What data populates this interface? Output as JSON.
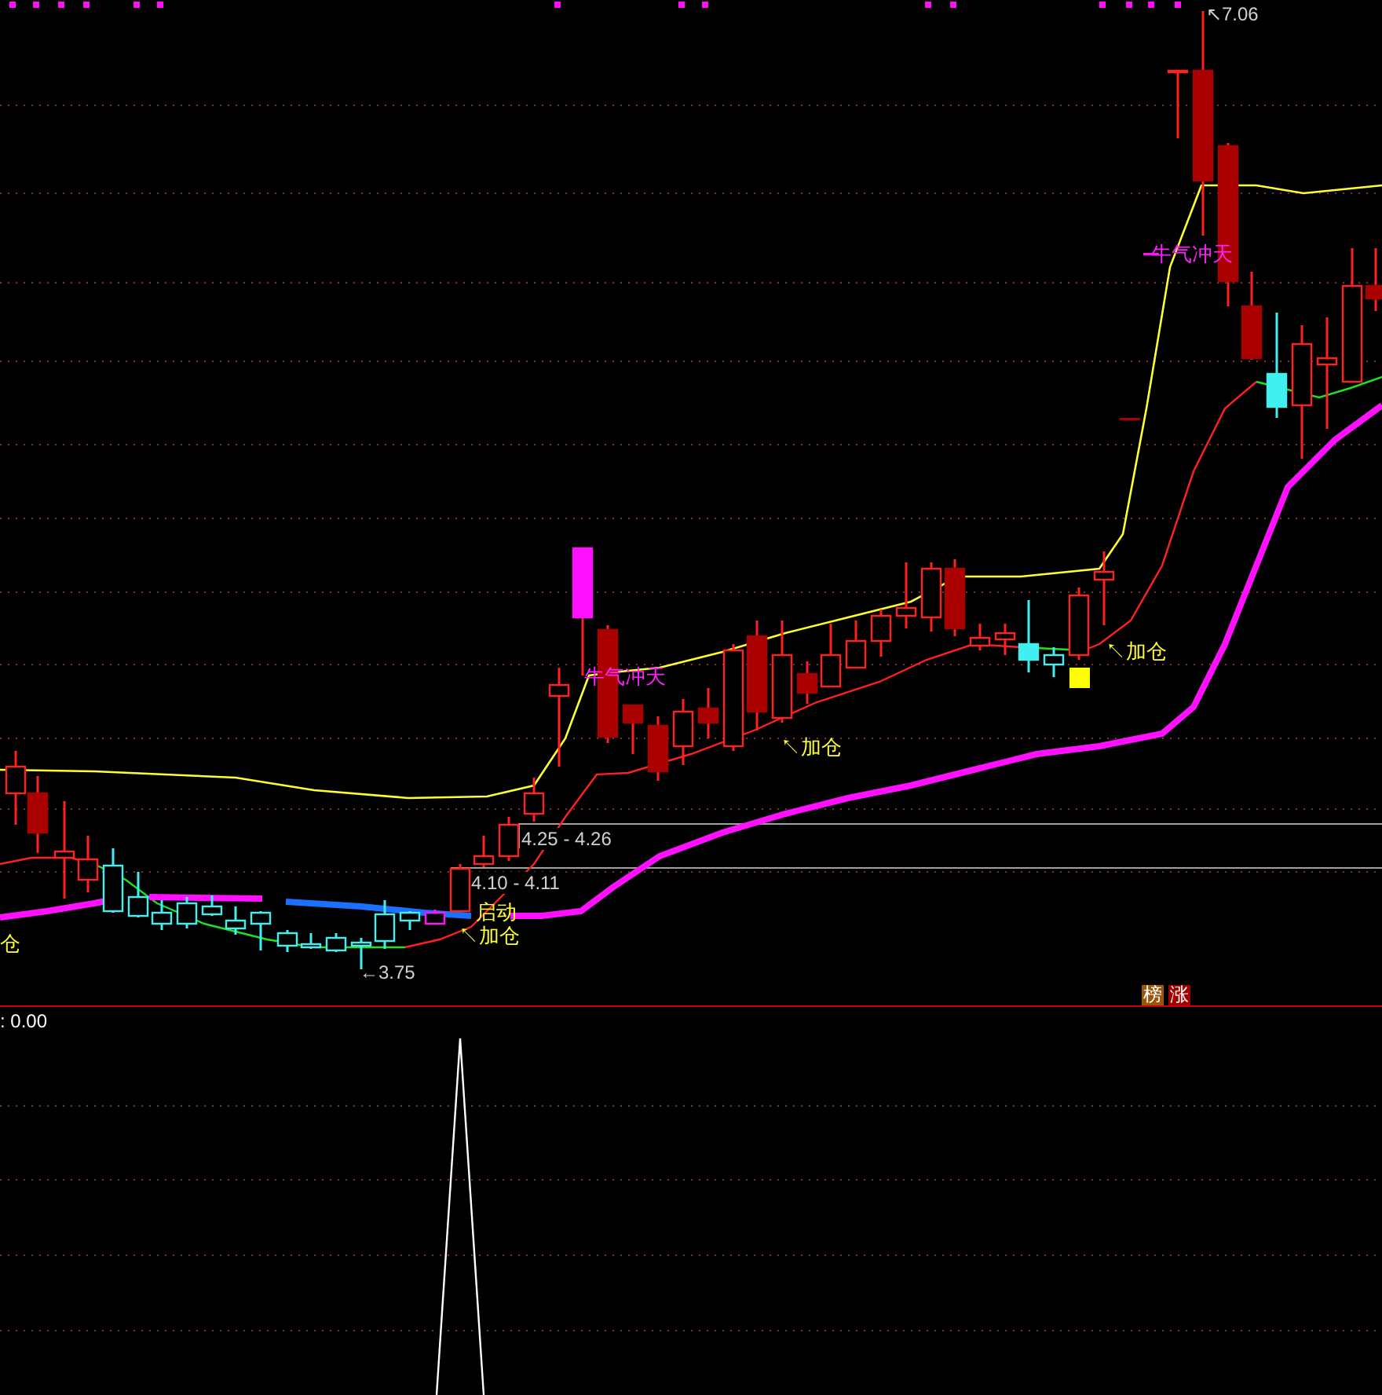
{
  "main_chart": {
    "high_price": {
      "marker": "↖",
      "text": "7.06"
    },
    "low_price": {
      "marker": "←",
      "text": "3.75"
    },
    "price_ranges": [
      "4.25 - 4.26",
      "4.10 - 4.11"
    ],
    "signals": [
      {
        "kind": "add",
        "text": "仓"
      },
      {
        "kind": "start",
        "text": "启动"
      },
      {
        "kind": "add",
        "marker": "↖",
        "text": "加仓"
      },
      {
        "kind": "bull",
        "text": "牛气冲天"
      },
      {
        "kind": "add",
        "marker": "↖",
        "text": "加仓"
      },
      {
        "kind": "add",
        "marker": "↖",
        "text": "加仓"
      },
      {
        "kind": "bull",
        "text": "牛气冲天"
      }
    ],
    "badges": [
      {
        "text": "榜",
        "color": "#98560c"
      },
      {
        "text": "涨",
        "color": "#a00000"
      }
    ]
  },
  "indicator_panel": {
    "reading": ": 0.00"
  }
}
